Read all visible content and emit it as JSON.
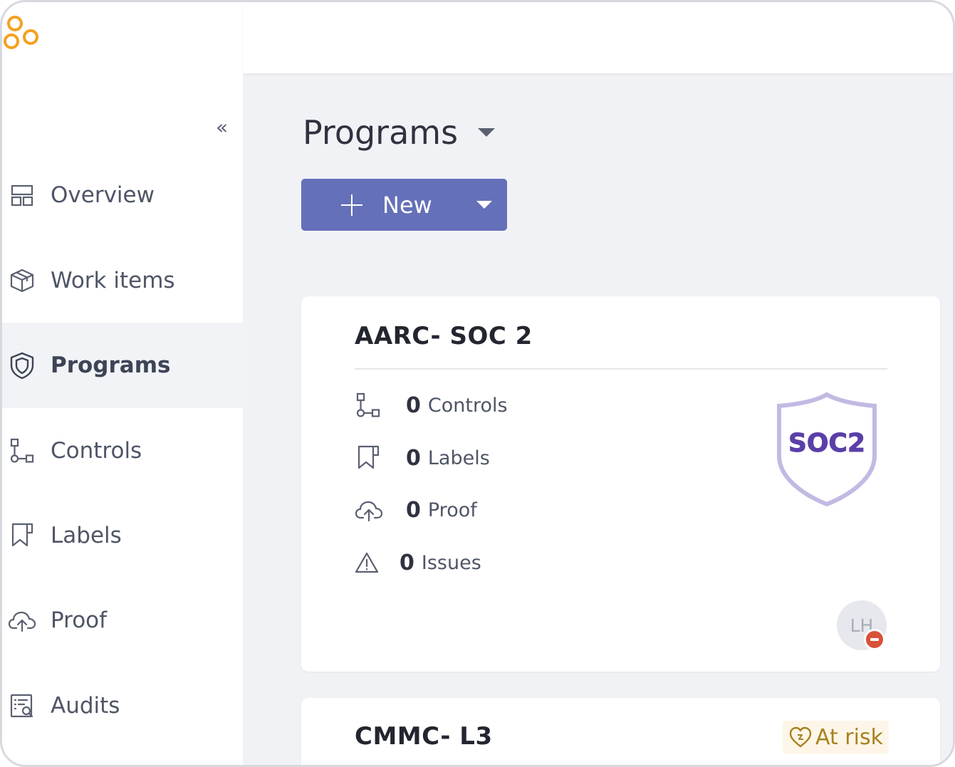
{
  "sidebar": {
    "collapse_glyph": "«",
    "items": [
      {
        "label": "Overview",
        "icon": "layout-icon"
      },
      {
        "label": "Work items",
        "icon": "box-icon"
      },
      {
        "label": "Programs",
        "icon": "shield-icon",
        "active": true
      },
      {
        "label": "Controls",
        "icon": "controls-icon"
      },
      {
        "label": "Labels",
        "icon": "label-icon"
      },
      {
        "label": "Proof",
        "icon": "cloud-upload-icon"
      },
      {
        "label": "Audits",
        "icon": "audit-list-icon"
      }
    ]
  },
  "header": {
    "title": "Programs"
  },
  "toolbar": {
    "new_label": "New"
  },
  "colors": {
    "accent": "#6470b8",
    "logo": "#f5a020",
    "badge_purple": "#5a3fa8",
    "risk_text": "#a9811e",
    "risk_bg": "#fdf6e8"
  },
  "programs": [
    {
      "title": "AARC- SOC 2",
      "stats": [
        {
          "count": "0",
          "label": "Controls",
          "icon": "controls-icon"
        },
        {
          "count": "0",
          "label": "Labels",
          "icon": "label-icon"
        },
        {
          "count": "0",
          "label": "Proof",
          "icon": "cloud-upload-icon"
        },
        {
          "count": "0",
          "label": "Issues",
          "icon": "warning-icon"
        }
      ],
      "badge_text": "SOC2",
      "owner_initials": "LH"
    },
    {
      "title": "CMMC- L3",
      "status": "At risk"
    }
  ]
}
